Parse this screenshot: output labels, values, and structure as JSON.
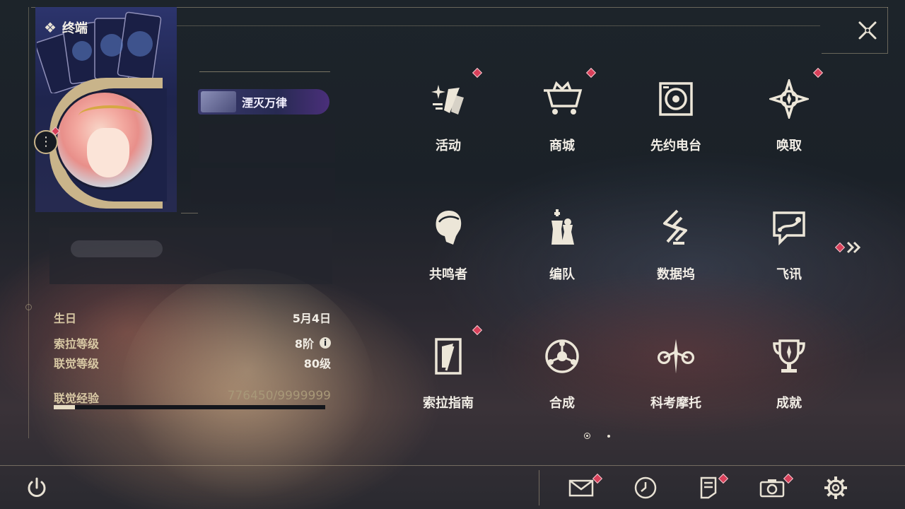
{
  "header": {
    "title": "终端"
  },
  "profile": {
    "title_badge": "湮灭万律",
    "birthday_label": "生日",
    "birthday_value": "5月4日",
    "sola_level_label": "索拉等级",
    "sola_level_value": "8阶",
    "union_level_label": "联觉等级",
    "union_level_value": "80级",
    "exp_label": "联觉经验",
    "exp_value": "776450/9999999",
    "exp_progress": 0.0776
  },
  "menu": {
    "page1": [
      {
        "label": "活动",
        "icon": "sparkle-icon",
        "badge": true
      },
      {
        "label": "商城",
        "icon": "shop-cart-icon",
        "badge": true
      },
      {
        "label": "先约电台",
        "icon": "radio-icon",
        "badge": false
      },
      {
        "label": "唤取",
        "icon": "compass-star-icon",
        "badge": true
      },
      {
        "label": "共鸣者",
        "icon": "resonator-head-icon",
        "badge": false
      },
      {
        "label": "编队",
        "icon": "chess-pieces-icon",
        "badge": false
      },
      {
        "label": "数据坞",
        "icon": "data-dock-icon",
        "badge": false
      },
      {
        "label": "飞讯",
        "icon": "chat-bubble-icon",
        "badge": false
      },
      {
        "label": "索拉指南",
        "icon": "guide-book-icon",
        "badge": true
      },
      {
        "label": "合成",
        "icon": "synthesis-icon",
        "badge": false
      },
      {
        "label": "科考摩托",
        "icon": "motorcycle-icon",
        "badge": false
      },
      {
        "label": "成就",
        "icon": "trophy-icon",
        "badge": false
      }
    ]
  },
  "pagination": {
    "current": 1,
    "total": 2
  },
  "bottom_bar": {
    "items": [
      "power-icon",
      "mail-icon",
      "clock-icon",
      "notice-icon",
      "camera-icon",
      "settings-gear-icon"
    ]
  },
  "colors": {
    "accent_gold": "#c9b48a",
    "badge_red": "#d9405a",
    "text_light": "#f2eee6"
  }
}
